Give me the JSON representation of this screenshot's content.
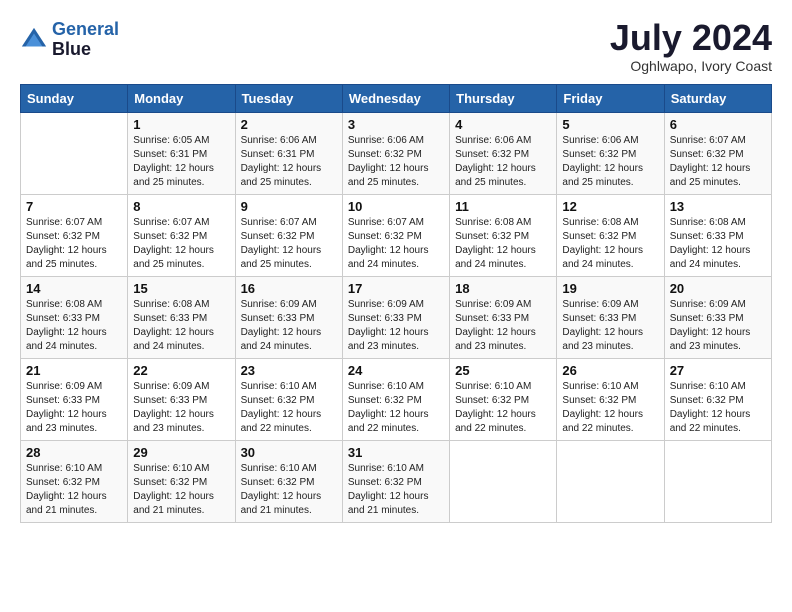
{
  "header": {
    "logo_line1": "General",
    "logo_line2": "Blue",
    "month": "July 2024",
    "location": "Oghlwapo, Ivory Coast"
  },
  "weekdays": [
    "Sunday",
    "Monday",
    "Tuesday",
    "Wednesday",
    "Thursday",
    "Friday",
    "Saturday"
  ],
  "weeks": [
    [
      {
        "day": "",
        "sunrise": "",
        "sunset": "",
        "daylight": ""
      },
      {
        "day": "1",
        "sunrise": "Sunrise: 6:05 AM",
        "sunset": "Sunset: 6:31 PM",
        "daylight": "Daylight: 12 hours and 25 minutes."
      },
      {
        "day": "2",
        "sunrise": "Sunrise: 6:06 AM",
        "sunset": "Sunset: 6:31 PM",
        "daylight": "Daylight: 12 hours and 25 minutes."
      },
      {
        "day": "3",
        "sunrise": "Sunrise: 6:06 AM",
        "sunset": "Sunset: 6:32 PM",
        "daylight": "Daylight: 12 hours and 25 minutes."
      },
      {
        "day": "4",
        "sunrise": "Sunrise: 6:06 AM",
        "sunset": "Sunset: 6:32 PM",
        "daylight": "Daylight: 12 hours and 25 minutes."
      },
      {
        "day": "5",
        "sunrise": "Sunrise: 6:06 AM",
        "sunset": "Sunset: 6:32 PM",
        "daylight": "Daylight: 12 hours and 25 minutes."
      },
      {
        "day": "6",
        "sunrise": "Sunrise: 6:07 AM",
        "sunset": "Sunset: 6:32 PM",
        "daylight": "Daylight: 12 hours and 25 minutes."
      }
    ],
    [
      {
        "day": "7",
        "sunrise": "Sunrise: 6:07 AM",
        "sunset": "Sunset: 6:32 PM",
        "daylight": "Daylight: 12 hours and 25 minutes."
      },
      {
        "day": "8",
        "sunrise": "Sunrise: 6:07 AM",
        "sunset": "Sunset: 6:32 PM",
        "daylight": "Daylight: 12 hours and 25 minutes."
      },
      {
        "day": "9",
        "sunrise": "Sunrise: 6:07 AM",
        "sunset": "Sunset: 6:32 PM",
        "daylight": "Daylight: 12 hours and 25 minutes."
      },
      {
        "day": "10",
        "sunrise": "Sunrise: 6:07 AM",
        "sunset": "Sunset: 6:32 PM",
        "daylight": "Daylight: 12 hours and 24 minutes."
      },
      {
        "day": "11",
        "sunrise": "Sunrise: 6:08 AM",
        "sunset": "Sunset: 6:32 PM",
        "daylight": "Daylight: 12 hours and 24 minutes."
      },
      {
        "day": "12",
        "sunrise": "Sunrise: 6:08 AM",
        "sunset": "Sunset: 6:32 PM",
        "daylight": "Daylight: 12 hours and 24 minutes."
      },
      {
        "day": "13",
        "sunrise": "Sunrise: 6:08 AM",
        "sunset": "Sunset: 6:33 PM",
        "daylight": "Daylight: 12 hours and 24 minutes."
      }
    ],
    [
      {
        "day": "14",
        "sunrise": "Sunrise: 6:08 AM",
        "sunset": "Sunset: 6:33 PM",
        "daylight": "Daylight: 12 hours and 24 minutes."
      },
      {
        "day": "15",
        "sunrise": "Sunrise: 6:08 AM",
        "sunset": "Sunset: 6:33 PM",
        "daylight": "Daylight: 12 hours and 24 minutes."
      },
      {
        "day": "16",
        "sunrise": "Sunrise: 6:09 AM",
        "sunset": "Sunset: 6:33 PM",
        "daylight": "Daylight: 12 hours and 24 minutes."
      },
      {
        "day": "17",
        "sunrise": "Sunrise: 6:09 AM",
        "sunset": "Sunset: 6:33 PM",
        "daylight": "Daylight: 12 hours and 23 minutes."
      },
      {
        "day": "18",
        "sunrise": "Sunrise: 6:09 AM",
        "sunset": "Sunset: 6:33 PM",
        "daylight": "Daylight: 12 hours and 23 minutes."
      },
      {
        "day": "19",
        "sunrise": "Sunrise: 6:09 AM",
        "sunset": "Sunset: 6:33 PM",
        "daylight": "Daylight: 12 hours and 23 minutes."
      },
      {
        "day": "20",
        "sunrise": "Sunrise: 6:09 AM",
        "sunset": "Sunset: 6:33 PM",
        "daylight": "Daylight: 12 hours and 23 minutes."
      }
    ],
    [
      {
        "day": "21",
        "sunrise": "Sunrise: 6:09 AM",
        "sunset": "Sunset: 6:33 PM",
        "daylight": "Daylight: 12 hours and 23 minutes."
      },
      {
        "day": "22",
        "sunrise": "Sunrise: 6:09 AM",
        "sunset": "Sunset: 6:33 PM",
        "daylight": "Daylight: 12 hours and 23 minutes."
      },
      {
        "day": "23",
        "sunrise": "Sunrise: 6:10 AM",
        "sunset": "Sunset: 6:32 PM",
        "daylight": "Daylight: 12 hours and 22 minutes."
      },
      {
        "day": "24",
        "sunrise": "Sunrise: 6:10 AM",
        "sunset": "Sunset: 6:32 PM",
        "daylight": "Daylight: 12 hours and 22 minutes."
      },
      {
        "day": "25",
        "sunrise": "Sunrise: 6:10 AM",
        "sunset": "Sunset: 6:32 PM",
        "daylight": "Daylight: 12 hours and 22 minutes."
      },
      {
        "day": "26",
        "sunrise": "Sunrise: 6:10 AM",
        "sunset": "Sunset: 6:32 PM",
        "daylight": "Daylight: 12 hours and 22 minutes."
      },
      {
        "day": "27",
        "sunrise": "Sunrise: 6:10 AM",
        "sunset": "Sunset: 6:32 PM",
        "daylight": "Daylight: 12 hours and 22 minutes."
      }
    ],
    [
      {
        "day": "28",
        "sunrise": "Sunrise: 6:10 AM",
        "sunset": "Sunset: 6:32 PM",
        "daylight": "Daylight: 12 hours and 21 minutes."
      },
      {
        "day": "29",
        "sunrise": "Sunrise: 6:10 AM",
        "sunset": "Sunset: 6:32 PM",
        "daylight": "Daylight: 12 hours and 21 minutes."
      },
      {
        "day": "30",
        "sunrise": "Sunrise: 6:10 AM",
        "sunset": "Sunset: 6:32 PM",
        "daylight": "Daylight: 12 hours and 21 minutes."
      },
      {
        "day": "31",
        "sunrise": "Sunrise: 6:10 AM",
        "sunset": "Sunset: 6:32 PM",
        "daylight": "Daylight: 12 hours and 21 minutes."
      },
      {
        "day": "",
        "sunrise": "",
        "sunset": "",
        "daylight": ""
      },
      {
        "day": "",
        "sunrise": "",
        "sunset": "",
        "daylight": ""
      },
      {
        "day": "",
        "sunrise": "",
        "sunset": "",
        "daylight": ""
      }
    ]
  ]
}
